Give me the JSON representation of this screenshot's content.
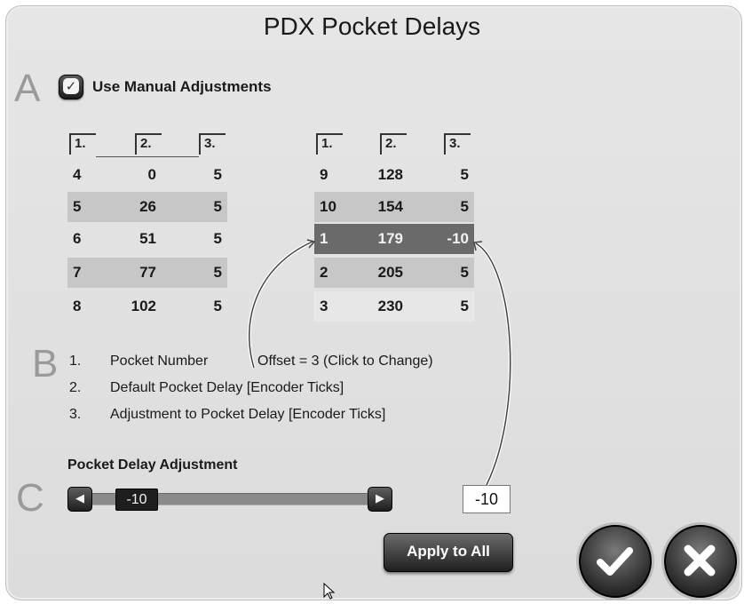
{
  "dialog": {
    "title": "PDX Pocket Delays",
    "section_letters": {
      "a": "A",
      "b": "B",
      "c": "C"
    }
  },
  "manual": {
    "label": "Use Manual Adjustments",
    "checked": true
  },
  "column_headers": [
    "1.",
    "2.",
    "3."
  ],
  "table_left": [
    {
      "pocket": "4",
      "delay": "0",
      "adjust": "5"
    },
    {
      "pocket": "5",
      "delay": "26",
      "adjust": "5"
    },
    {
      "pocket": "6",
      "delay": "51",
      "adjust": "5"
    },
    {
      "pocket": "7",
      "delay": "77",
      "adjust": "5"
    },
    {
      "pocket": "8",
      "delay": "102",
      "adjust": "5"
    }
  ],
  "table_right": [
    {
      "pocket": "9",
      "delay": "128",
      "adjust": "5"
    },
    {
      "pocket": "10",
      "delay": "154",
      "adjust": "5"
    },
    {
      "pocket": "1",
      "delay": "179",
      "adjust": "-10",
      "selected": true
    },
    {
      "pocket": "2",
      "delay": "205",
      "adjust": "5"
    },
    {
      "pocket": "3",
      "delay": "230",
      "adjust": "5"
    }
  ],
  "legend": [
    {
      "num": "1.",
      "text": "Pocket Number"
    },
    {
      "num": "2.",
      "text": "Default Pocket Delay [Encoder Ticks]"
    },
    {
      "num": "3.",
      "text": "Adjustment to Pocket Delay [Encoder Ticks]"
    }
  ],
  "offset": {
    "text": "Offset = 3  (Click to Change)"
  },
  "adjustment": {
    "title": "Pocket Delay Adjustment",
    "slider_value": "-10",
    "value_box": "-10"
  },
  "buttons": {
    "apply_all": "Apply to All"
  },
  "icons": {
    "ok": "checkmark-icon",
    "cancel": "x-icon",
    "decrement": "triangle-left-icon",
    "increment": "triangle-right-icon"
  },
  "colors": {
    "selected_row": "#6a6a6a",
    "alt_row": "#c7c7c7",
    "button_dark": "#1f1f1f"
  }
}
